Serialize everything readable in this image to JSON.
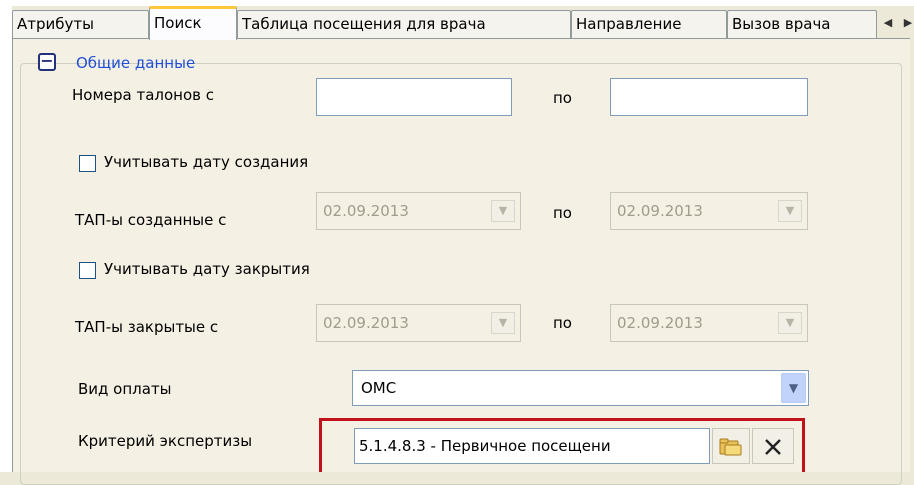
{
  "tabs": [
    {
      "label": "Атрибуты",
      "active": false
    },
    {
      "label": "Поиск",
      "active": true
    },
    {
      "label": "Таблица посещения для врача",
      "active": false
    },
    {
      "label": "Направление",
      "active": false
    },
    {
      "label": "Вызов врача",
      "active": false
    }
  ],
  "group": {
    "title": "Общие данные",
    "collapse_symbol": "−"
  },
  "talon": {
    "label": "Номера талонов с",
    "from_value": "",
    "to_label": "по",
    "to_value": ""
  },
  "created": {
    "checkbox_label": "Учитывать дату создания",
    "checked": false,
    "range_label": "ТАП-ы созданные с",
    "from_value": "02.09.2013",
    "to_label": "по",
    "to_value": "02.09.2013"
  },
  "closed": {
    "checkbox_label": "Учитывать дату закрытия",
    "checked": false,
    "range_label": "ТАП-ы закрытые с",
    "from_value": "02.09.2013",
    "to_label": "по",
    "to_value": "02.09.2013"
  },
  "payment": {
    "label": "Вид оплаты",
    "value": "ОМС"
  },
  "criteria": {
    "label": "Критерий экспертизы",
    "value": "5.1.4.8.3 - Первичное посещени"
  },
  "colors": {
    "highlight": "#c1121c",
    "group_title": "#1f4fd8",
    "active_tab_accent": "#ffc83c"
  },
  "icons": {
    "browse": "folder-browse-icon",
    "clear": "close-icon",
    "scroll_left": "scroll-left-icon",
    "scroll_right": "scroll-right-icon",
    "dropdown": "chevron-down-icon"
  }
}
